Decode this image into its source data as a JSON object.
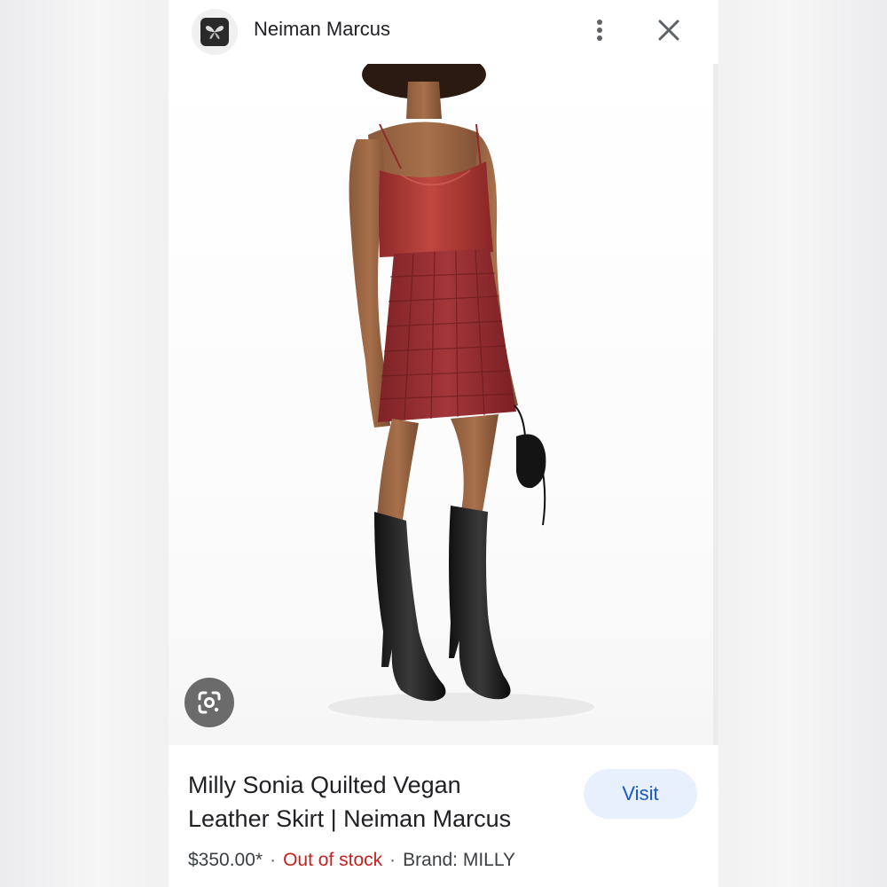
{
  "header": {
    "site_name": "Neiman Marcus",
    "favicon_icon": "butterfly-icon",
    "more_icon": "more-vert-icon",
    "close_icon": "close-icon"
  },
  "image": {
    "lens_icon": "google-lens-icon"
  },
  "product": {
    "title_line1": "Milly Sonia Quilted Vegan",
    "title_line2": "Leather Skirt | Neiman Marcus",
    "visit_label": "Visit",
    "price": "$350.00*",
    "separator": "·",
    "stock_status": "Out of stock",
    "brand": "Brand: MILLY"
  },
  "colors": {
    "stock_red": "#c5221f",
    "visit_bg": "#e8f0fe",
    "visit_text": "#1a57c4"
  }
}
